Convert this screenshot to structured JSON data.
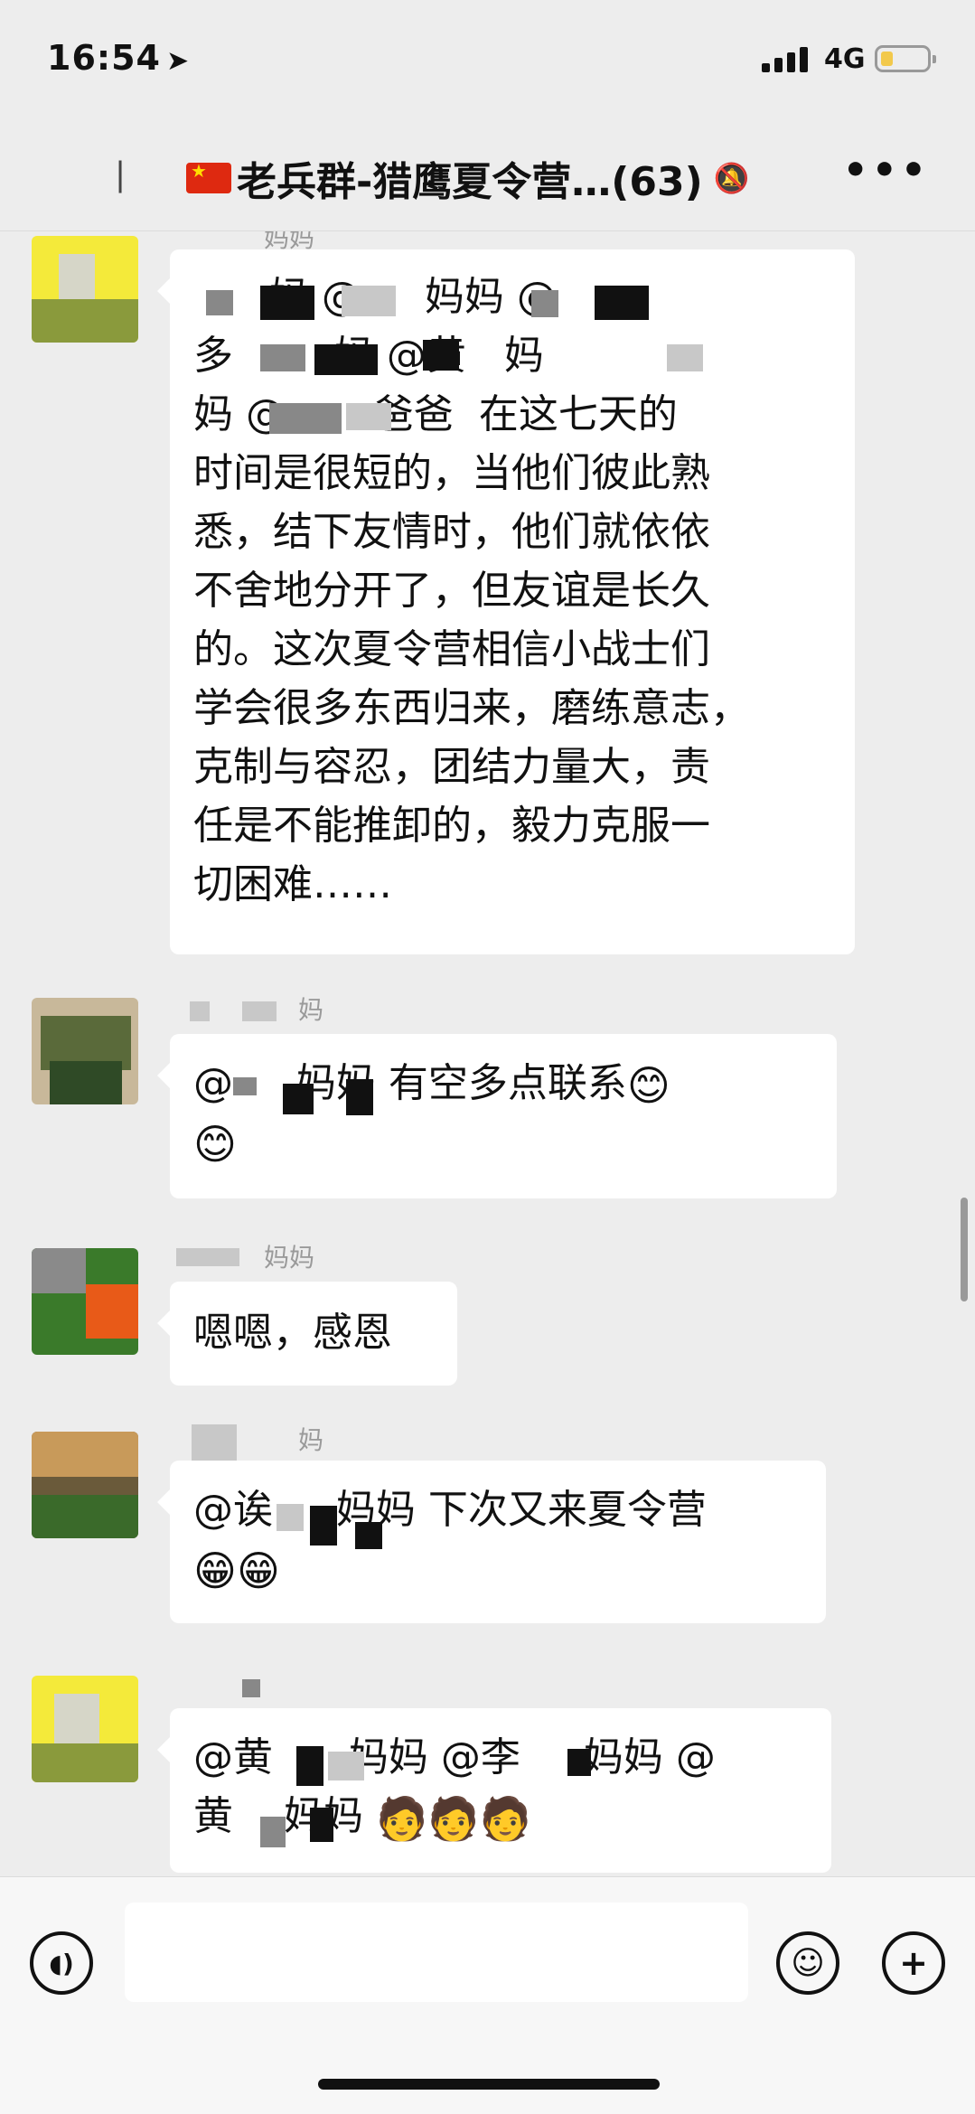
{
  "status_bar": {
    "time": "16:54",
    "network": "4G",
    "battery_level": 0.2
  },
  "nav": {
    "title": "老兵群-猎鹰夏令营…(63)",
    "flag_icon": "china-flag-icon",
    "mute_icon": "muted-bell-icon",
    "more_icon": "more-dots-icon"
  },
  "messages": [
    {
      "nickname": "妈妈",
      "lines": [
        "      妈 @     妈妈 @",
        "多        妈 @黄   妈",
        "妈 @       爸爸  在这七天的",
        "时间是很短的，当他们彼此熟",
        "悉，结下友情时，他们就依依",
        "不舍地分开了，但友谊是长久",
        "的。这次夏令营相信小战士们",
        "学会很多东西归来，磨练意志，",
        "克制与容忍，团结力量大，责",
        "任是不能推卸的，毅力克服一",
        "切困难……"
      ]
    },
    {
      "nickname": "妈",
      "text": "@     妈妈 有空多点联系",
      "emoji": "😊"
    },
    {
      "nickname": "妈妈",
      "text": "嗯嗯，感恩"
    },
    {
      "nickname": "妈",
      "text": "@诶     妈妈 下次又来夏令营",
      "emoji": "😁"
    },
    {
      "nickname": "",
      "line1": "@黄      妈妈 @李     妈妈 @",
      "line2": "黄    妈妈",
      "emoji": "🧑"
    }
  ],
  "colors": {
    "background": "#ededed",
    "bubble": "#ffffff",
    "nickname": "#9a9a9a",
    "flag_red": "#de2910",
    "battery": "#f2c94c"
  }
}
